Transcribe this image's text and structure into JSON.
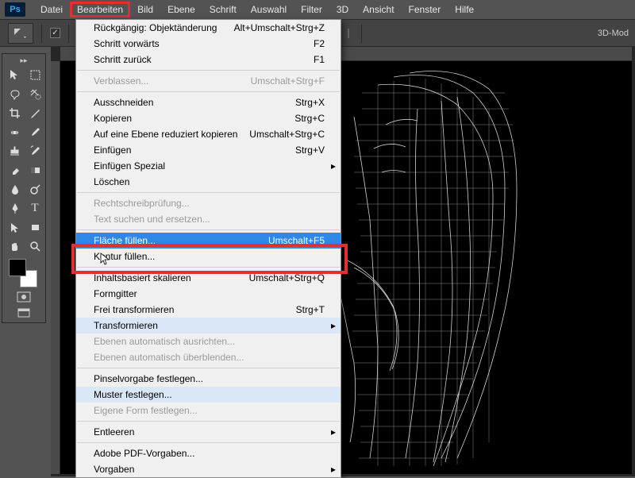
{
  "app": {
    "logo": "Ps"
  },
  "menubar": [
    "Datei",
    "Bearbeiten",
    "Bild",
    "Ebene",
    "Schrift",
    "Auswahl",
    "Filter",
    "3D",
    "Ansicht",
    "Fenster",
    "Hilfe"
  ],
  "highlighted_menu_index": 1,
  "options_bar": {
    "mode_label": "3D-Mod"
  },
  "dropdown": {
    "groups": [
      [
        {
          "label": "Rückgängig: Objektänderung",
          "shortcut": "Alt+Umschalt+Strg+Z"
        },
        {
          "label": "Schritt vorwärts",
          "shortcut": "F2"
        },
        {
          "label": "Schritt zurück",
          "shortcut": "F1"
        }
      ],
      [
        {
          "label": "Verblassen...",
          "shortcut": "Umschalt+Strg+F",
          "disabled": true
        }
      ],
      [
        {
          "label": "Ausschneiden",
          "shortcut": "Strg+X"
        },
        {
          "label": "Kopieren",
          "shortcut": "Strg+C"
        },
        {
          "label": "Auf eine Ebene reduziert kopieren",
          "shortcut": "Umschalt+Strg+C"
        },
        {
          "label": "Einfügen",
          "shortcut": "Strg+V"
        },
        {
          "label": "Einfügen Spezial",
          "submenu": true
        },
        {
          "label": "Löschen"
        }
      ],
      [
        {
          "label": "Rechtschreibprüfung...",
          "disabled": true
        },
        {
          "label": "Text suchen und ersetzen...",
          "disabled": true
        }
      ],
      [
        {
          "label": "Fläche füllen...",
          "shortcut": "Umschalt+F5",
          "hover": true
        },
        {
          "label": "Kontur füllen..."
        }
      ],
      [
        {
          "label": "Inhaltsbasiert skalieren",
          "shortcut": "Umschalt+Strg+Q"
        },
        {
          "label": "Formgitter"
        },
        {
          "label": "Frei transformieren",
          "shortcut": "Strg+T"
        },
        {
          "label": "Transformieren",
          "submenu": true,
          "submenu_open": true
        },
        {
          "label": "Ebenen automatisch ausrichten...",
          "disabled": true
        },
        {
          "label": "Ebenen automatisch überblenden...",
          "disabled": true
        }
      ],
      [
        {
          "label": "Pinselvorgabe festlegen..."
        },
        {
          "label": "Muster festlegen...",
          "submenu_open": true
        },
        {
          "label": "Eigene Form festlegen...",
          "disabled": true
        }
      ],
      [
        {
          "label": "Entleeren",
          "submenu": true
        }
      ],
      [
        {
          "label": "Adobe PDF-Vorgaben..."
        },
        {
          "label": "Vorgaben",
          "submenu": true
        }
      ]
    ]
  },
  "colors": {
    "highlight_red": "#e03030",
    "menu_hover": "#2f87e8"
  }
}
